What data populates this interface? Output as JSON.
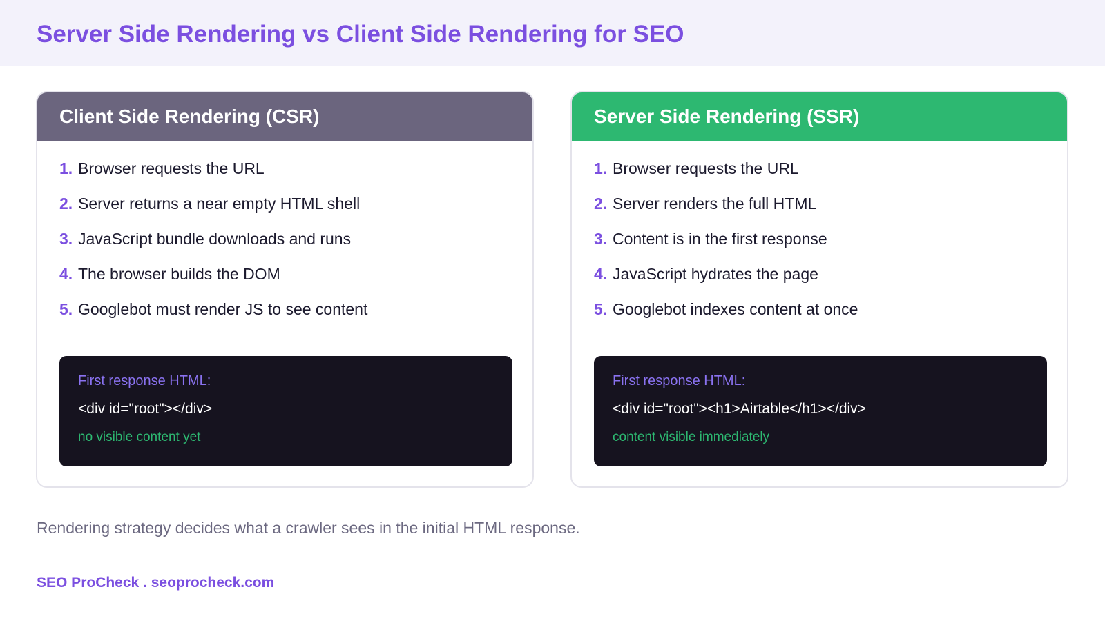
{
  "header": {
    "title": "Server Side Rendering vs Client Side Rendering for SEO"
  },
  "csr": {
    "title": "Client Side Rendering (CSR)",
    "steps": [
      {
        "num": "1.",
        "text": "Browser requests the URL"
      },
      {
        "num": "2.",
        "text": "Server returns a near empty HTML shell"
      },
      {
        "num": "3.",
        "text": "JavaScript bundle downloads and runs"
      },
      {
        "num": "4.",
        "text": "The browser builds the DOM"
      },
      {
        "num": "5.",
        "text": "Googlebot must render JS to see content"
      }
    ],
    "code": {
      "label": "First response HTML:",
      "line": "<div id=\"root\"></div>",
      "note": "no visible content yet"
    }
  },
  "ssr": {
    "title": "Server Side Rendering (SSR)",
    "steps": [
      {
        "num": "1.",
        "text": "Browser requests the URL"
      },
      {
        "num": "2.",
        "text": "Server renders the full HTML"
      },
      {
        "num": "3.",
        "text": "Content is in the first response"
      },
      {
        "num": "4.",
        "text": "JavaScript hydrates the page"
      },
      {
        "num": "5.",
        "text": "Googlebot indexes content at once"
      }
    ],
    "code": {
      "label": "First response HTML:",
      "line": "<div id=\"root\"><h1>Airtable</h1></div>",
      "note": "content visible immediately"
    }
  },
  "caption": "Rendering strategy decides what a crawler sees in the initial HTML response.",
  "footer": {
    "brand": "SEO ProCheck . seoprocheck.com"
  },
  "colors": {
    "accent": "#7b4fe0",
    "csr_header": "#6b657e",
    "ssr_header": "#2db871",
    "code_bg": "#16131f"
  }
}
